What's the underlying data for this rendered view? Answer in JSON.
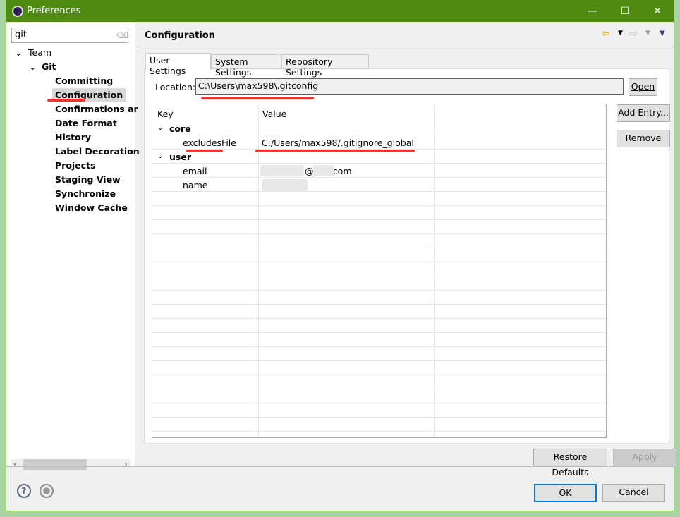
{
  "window": {
    "title": "Preferences",
    "minimize": "—",
    "maximize": "☐",
    "close": "✕"
  },
  "filter": {
    "value": "git"
  },
  "tree": {
    "team": "Team",
    "git": "Git",
    "items": [
      "Committing",
      "Configuration",
      "Confirmations ar",
      "Date Format",
      "History",
      "Label Decoration",
      "Projects",
      "Staging View",
      "Synchronize",
      "Window Cache"
    ],
    "selected": "Configuration"
  },
  "page": {
    "title": "Configuration"
  },
  "tabs": [
    "User Settings",
    "System Settings",
    "Repository Settings"
  ],
  "location": {
    "label": "Location:",
    "value": "C:\\Users\\max598\\.gitconfig",
    "open": "Open"
  },
  "table": {
    "headers": [
      "Key",
      "Value"
    ],
    "rows": [
      {
        "key": "core",
        "value": "",
        "section": true
      },
      {
        "key": "excludesFile",
        "value": "C:/Users/max598/.gitignore_global"
      },
      {
        "key": "user",
        "value": "",
        "section": true
      },
      {
        "key": "email",
        "value": "@l     .com"
      },
      {
        "key": "name",
        "value": ""
      }
    ]
  },
  "buttons": {
    "add_entry": "Add Entry...",
    "remove": "Remove",
    "restore_defaults": "Restore Defaults",
    "apply": "Apply",
    "ok": "OK",
    "cancel": "Cancel"
  },
  "colors": {
    "titlebar": "#4e8b10",
    "annotation": "#f03434",
    "focus": "#0078d7"
  }
}
